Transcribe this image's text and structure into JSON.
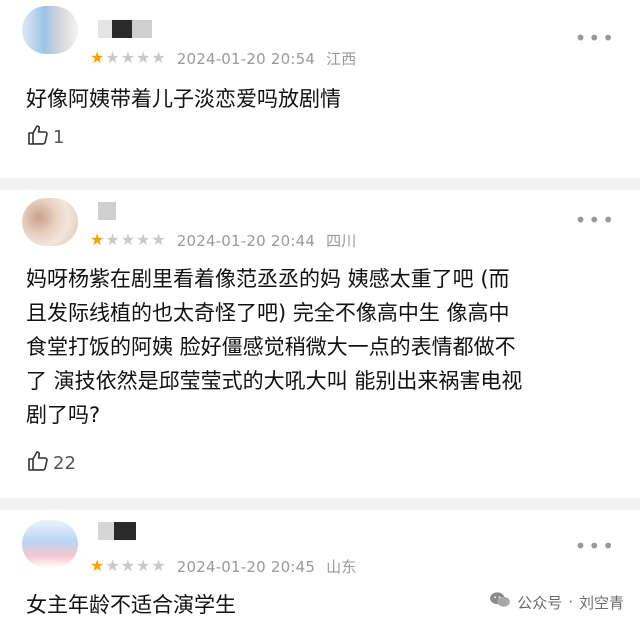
{
  "comments": [
    {
      "date": "2024-01-20 20:54",
      "location": "江西",
      "rating": 1,
      "max_rating": 5,
      "lines": [
        "好像阿姨带着儿子淡恋爱吗放剧情"
      ],
      "likes": "1"
    },
    {
      "date": "2024-01-20 20:44",
      "location": "四川",
      "rating": 1,
      "max_rating": 5,
      "lines": [
        "妈呀杨紫在剧里看着像范丞丞的妈 姨感太重了吧 (而",
        "且发际线植的也太奇怪了吧) 完全不像高中生 像高中",
        "食堂打饭的阿姨 脸好僵感觉稍微大一点的表情都做不",
        "了 演技依然是邱莹莹式的大吼大叫 能别出来祸害电视",
        "剧了吗?"
      ],
      "likes": "22"
    },
    {
      "date": "2024-01-20 20:45",
      "location": "山东",
      "rating": 1,
      "max_rating": 5,
      "lines": [
        "女主年龄不适合演学生"
      ],
      "likes": ""
    }
  ],
  "watermark": {
    "brand": "公众号",
    "author": "刘空青"
  },
  "colors": {
    "star_on": "#f4a300",
    "star_off": "#c9c9c9",
    "meta": "#9a9a9a",
    "separator": "#f1f1f1"
  },
  "icons": [
    "thumbs-up-icon",
    "more-icon",
    "wechat-icon"
  ]
}
